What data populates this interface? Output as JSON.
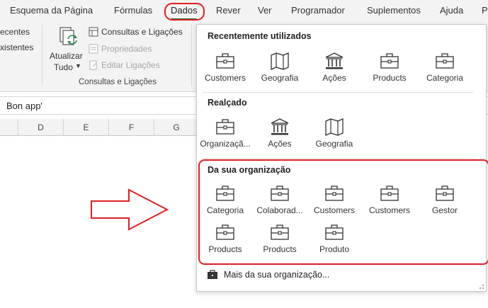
{
  "ribbon": {
    "tabs": [
      {
        "label": "Esquema da Página",
        "active": false
      },
      {
        "label": "Fórmulas",
        "active": false
      },
      {
        "label": "Dados",
        "active": true
      },
      {
        "label": "Rever",
        "active": false
      },
      {
        "label": "Ver",
        "active": false
      },
      {
        "label": "Programador",
        "active": false
      },
      {
        "label": "Suplementos",
        "active": false
      },
      {
        "label": "Ajuda",
        "active": false
      },
      {
        "label": "P",
        "active": false
      }
    ],
    "left_partial": [
      "ecentes",
      "xistentes"
    ],
    "refresh_all": {
      "line1": "Atualizar",
      "line2": "Tudo"
    },
    "queries_connections": "Consultas e Ligações",
    "properties": "Propriedades",
    "edit_links": "Editar Ligações",
    "group_label": "Consultas e Ligações"
  },
  "formula_bar": {
    "value": "Bon app'"
  },
  "columns": [
    "D",
    "E",
    "F",
    "G"
  ],
  "gallery": {
    "recent": {
      "title": "Recentemente utilizados",
      "items": [
        {
          "label": "Customers",
          "icon": "briefcase-icon"
        },
        {
          "label": "Geografia",
          "icon": "map-icon"
        },
        {
          "label": "Ações",
          "icon": "bank-icon"
        },
        {
          "label": "Products",
          "icon": "briefcase-icon"
        },
        {
          "label": "Categoria",
          "icon": "briefcase-icon"
        }
      ]
    },
    "featured": {
      "title": "Realçado",
      "items": [
        {
          "label": "Organizaçã...",
          "icon": "briefcase-icon"
        },
        {
          "label": "Ações",
          "icon": "bank-icon"
        },
        {
          "label": "Geografia",
          "icon": "map-icon"
        }
      ]
    },
    "organization": {
      "title": "Da sua organização",
      "items": [
        {
          "label": "Categoria",
          "icon": "briefcase-icon"
        },
        {
          "label": "Colaborad...",
          "icon": "briefcase-icon"
        },
        {
          "label": "Customers",
          "icon": "briefcase-icon"
        },
        {
          "label": "Customers",
          "icon": "briefcase-icon"
        },
        {
          "label": "Gestor",
          "icon": "briefcase-icon"
        },
        {
          "label": "Products",
          "icon": "briefcase-icon"
        },
        {
          "label": "Products",
          "icon": "briefcase-icon"
        },
        {
          "label": "Produto",
          "icon": "briefcase-icon"
        }
      ]
    },
    "more_link": "Mais da sua organização...",
    "colors": {
      "highlight": "#e01e24",
      "accent": "#107c41"
    }
  }
}
